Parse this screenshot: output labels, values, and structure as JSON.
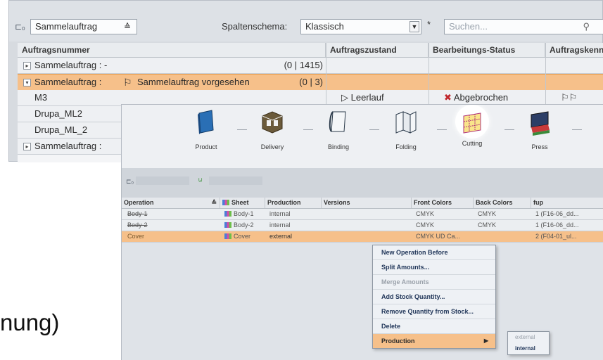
{
  "back_window": {
    "toolbar": {
      "view_combo_value": "Sammelauftrag",
      "column_schema_label": "Spaltenschema:",
      "column_schema_value": "Klassisch",
      "modified_marker": "*",
      "search_placeholder": "Suchen..."
    },
    "columns": [
      "Auftragsnummer",
      "Auftragszustand",
      "Bearbeitungs-Status",
      "Auftragskenn"
    ],
    "rows": [
      {
        "name": "Sammelauftrag : -",
        "count": "(0 | 1415)",
        "col2": "",
        "col3": "",
        "col4": ""
      },
      {
        "name": "Sammelauftrag : ",
        "name_suffix": "Sammelauftrag vorgesehen",
        "count": "(0 | 3)",
        "col2": "",
        "col3": "",
        "col4": ""
      },
      {
        "name": "M3",
        "count": "",
        "col2": "Leerlauf",
        "col3": "Abgebrochen",
        "col4": ""
      },
      {
        "name": "Drupa_ML2",
        "count": "",
        "col2": "",
        "col3": "",
        "col4": ""
      },
      {
        "name": "Drupa_ML_2",
        "count": "",
        "col2": "",
        "col3": "",
        "col4": ""
      },
      {
        "name": "Sammelauftrag :",
        "count": "",
        "col2": "",
        "col3": "",
        "col4": ""
      }
    ]
  },
  "caption_fragment": "nung)",
  "front_window": {
    "steps": [
      {
        "label": "Product"
      },
      {
        "label": "Delivery"
      },
      {
        "label": "Binding"
      },
      {
        "label": "Folding"
      },
      {
        "label": "Cutting"
      },
      {
        "label": "Press"
      }
    ],
    "columns": [
      "Operation",
      "Sheet",
      "Production",
      "Versions",
      "Front Colors",
      "Back Colors",
      "fup"
    ],
    "rows": [
      {
        "operation": "Body-1",
        "sheet": "Body-1",
        "production": "internal",
        "versions": "",
        "front": "CMYK",
        "back": "CMYK",
        "fup": "1 (F16-06_dd..."
      },
      {
        "operation": "Body-2",
        "sheet": "Body-2",
        "production": "internal",
        "versions": "",
        "front": "CMYK",
        "back": "CMYK",
        "fup": "1 (F16-06_dd..."
      },
      {
        "operation": "Cover",
        "sheet": "Cover",
        "production": "external",
        "versions": "",
        "front": "CMYK UD Ca...",
        "back": "",
        "fup": "2 (F04-01_ul..."
      }
    ],
    "context_menu": [
      {
        "label": "New Operation Before",
        "enabled": true
      },
      {
        "label": "Split Amounts...",
        "enabled": true
      },
      {
        "label": "Merge Amounts",
        "enabled": false
      },
      {
        "label": "Add Stock Quantity...",
        "enabled": true
      },
      {
        "label": "Remove Quantity from Stock...",
        "enabled": true
      },
      {
        "label": "Delete",
        "enabled": true
      },
      {
        "label": "Production",
        "enabled": true
      }
    ],
    "submenu": [
      {
        "label": "external",
        "enabled": false
      },
      {
        "label": "internal",
        "enabled": true
      }
    ]
  },
  "colors": {
    "selection": "#f6c08a",
    "header_bg": "#e9ecef",
    "menu_text": "#22375a"
  }
}
